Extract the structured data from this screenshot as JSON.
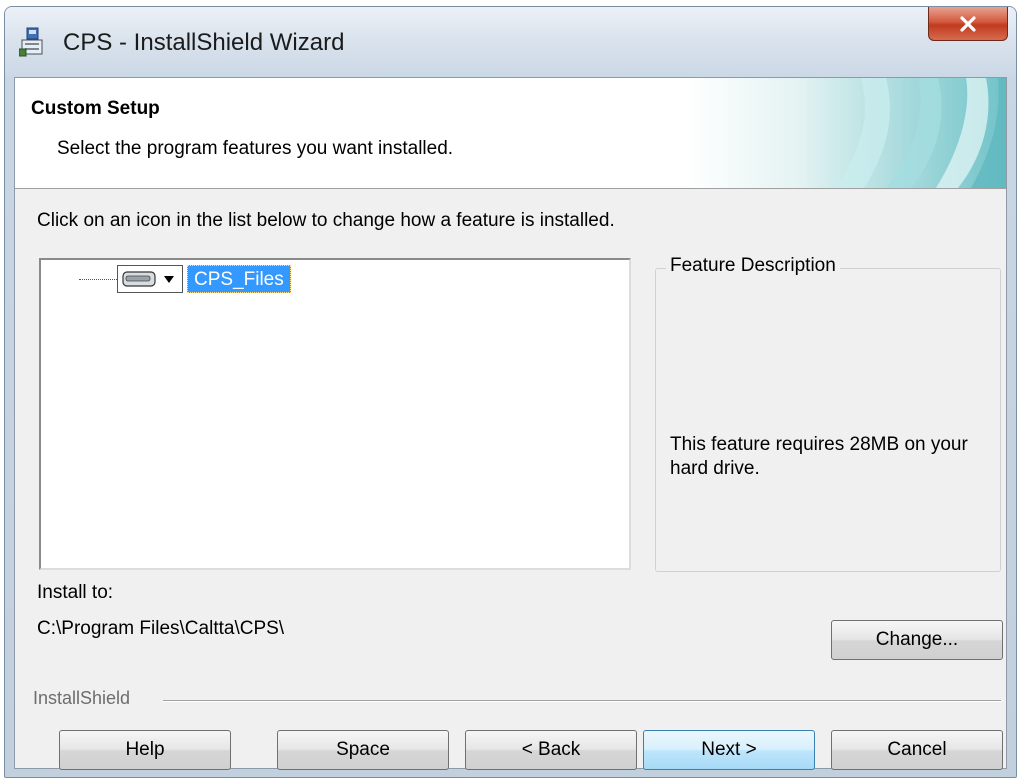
{
  "window": {
    "title": "CPS - InstallShield Wizard"
  },
  "banner": {
    "title": "Custom Setup",
    "subtitle": "Select the program features you want installed."
  },
  "instructions": "Click on an icon in the list below to change how a feature is installed.",
  "feature_tree": {
    "items": [
      {
        "label": "CPS_Files",
        "icon": "hard-drive-icon",
        "selected": true
      }
    ]
  },
  "feature_description": {
    "legend": "Feature Description",
    "text": "This feature requires 28MB on your hard drive."
  },
  "install_to": {
    "label": "Install to:",
    "path": "C:\\Program Files\\Caltta\\CPS\\",
    "change_label": "Change..."
  },
  "brand": "InstallShield",
  "buttons": {
    "help": "Help",
    "space": "Space",
    "back": "< Back",
    "next": "Next >",
    "cancel": "Cancel"
  },
  "colors": {
    "selection": "#3399ff",
    "close_button": "#c13b1f",
    "default_button": "#bee6fd"
  }
}
